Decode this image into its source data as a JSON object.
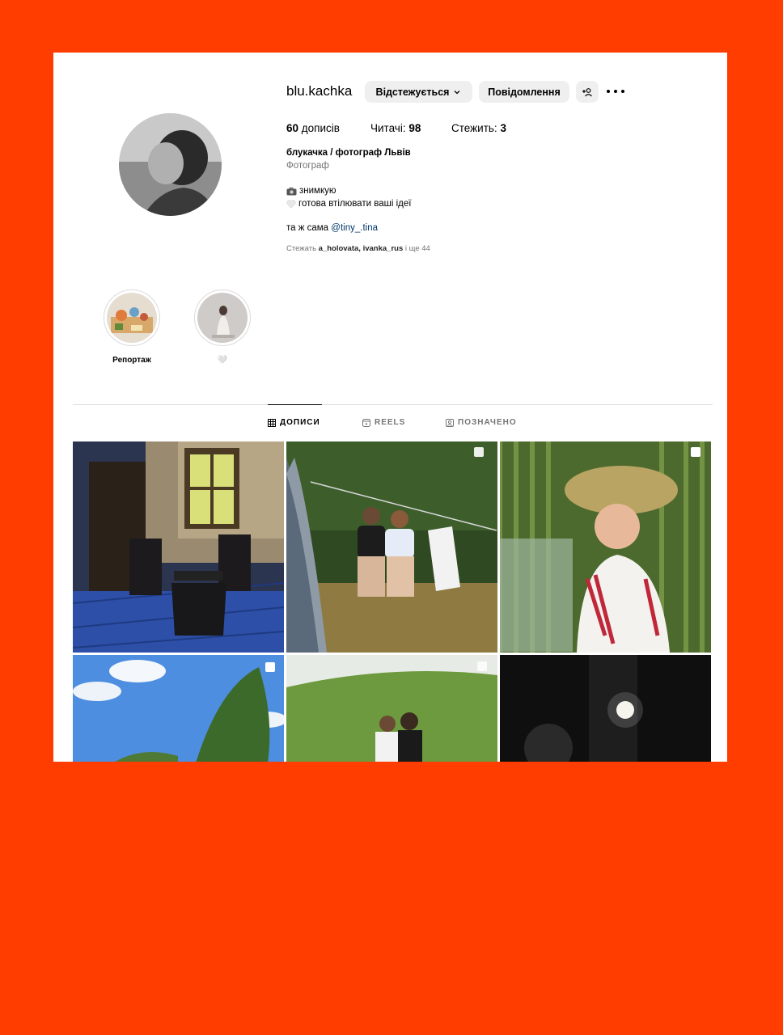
{
  "profile": {
    "username": "blu.kachka",
    "unfollow_label": "Відстежується",
    "message_label": "Повідомлення",
    "posts_count": "60",
    "posts_label": "дописів",
    "followers_label": "Читачі:",
    "followers_count": "98",
    "following_label": "Стежить:",
    "following_count": "3"
  },
  "bio": {
    "name": "блукачка / фотограф Львів",
    "category": "Фотограф",
    "line1": "знимкую",
    "line2": "готова втілювати ваші ідеї",
    "line3_prefix": "та ж сама",
    "line3_link": "@tiny_.tina",
    "followed_prefix": "Стежать",
    "followed_user1": "a_holovata",
    "followed_sep": ",",
    "followed_user2": "ivanka_rus",
    "followed_suffix": "і ще 44"
  },
  "highlights": [
    {
      "label": "Репортаж"
    },
    {
      "label": "🤍"
    }
  ],
  "tabs": [
    {
      "label": "ДОПИСИ",
      "active": true
    },
    {
      "label": "REELS",
      "active": false
    },
    {
      "label": "ПОЗНАЧЕНО",
      "active": false
    }
  ],
  "icons": {
    "bio_line1": "camera-emoji-icon",
    "bio_line2": "white-heart-icon"
  },
  "colors": {
    "background": "#ff3d00",
    "button": "#efefef",
    "link": "#00376b",
    "muted": "#737373"
  }
}
